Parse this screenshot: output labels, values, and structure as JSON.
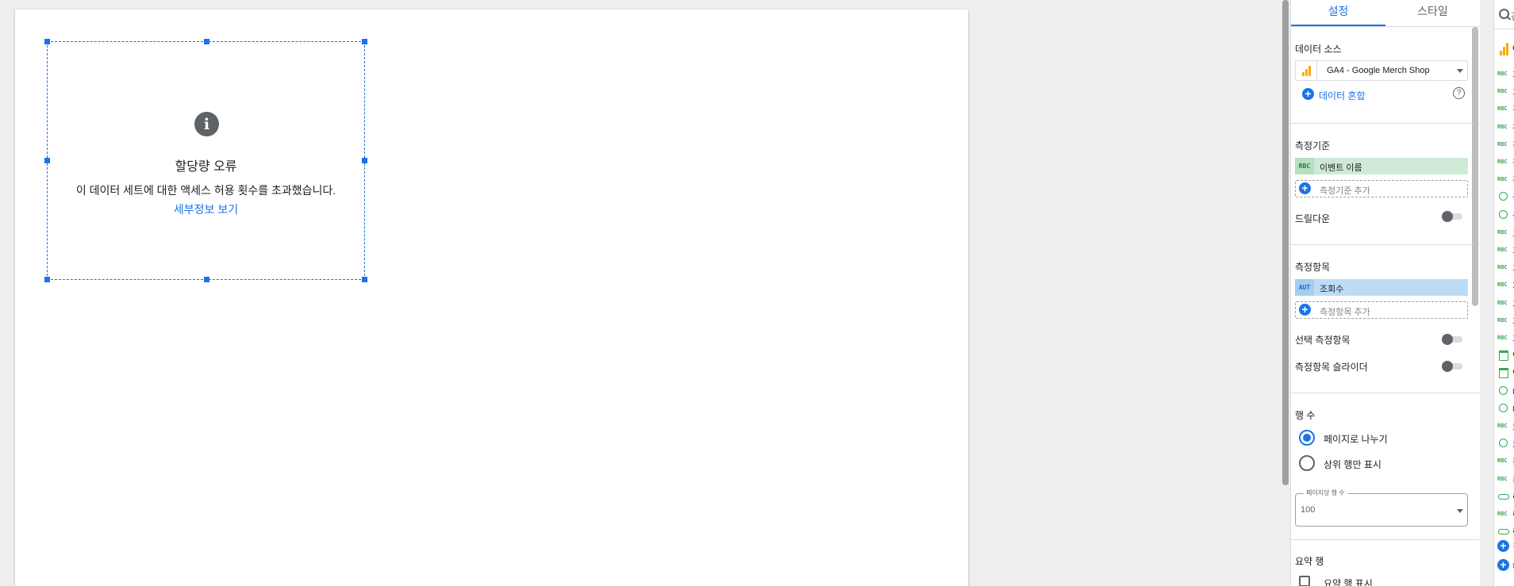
{
  "canvas": {
    "error": {
      "title": "할당량 오류",
      "message": "이 데이터 세트에 대한 액세스 허용 횟수를 초과했습니다.",
      "link": "세부정보 보기"
    }
  },
  "panel": {
    "tabs": [
      "설정",
      "스타일"
    ],
    "active_tab": "설정",
    "data_source": {
      "section_title": "데이터 소스",
      "name": "GA4 - Google Merch Shop",
      "blend_label": "데이터 혼합",
      "help": "?"
    },
    "dimension": {
      "section_title": "측정기준",
      "chip_tag": "RBC",
      "chip_label": "이벤트 이름",
      "add_label": "측정기준 추가",
      "drilldown_label": "드릴다운"
    },
    "metric": {
      "section_title": "측정항목",
      "chip_tag": "AUT",
      "chip_label": "조회수",
      "add_label": "측정항목 추가",
      "optional_label": "선택 측정항목",
      "slider_label": "측정항목 슬라이더"
    },
    "rows": {
      "section_title": "행 수",
      "option_paginate": "페이지로 나누기",
      "option_top": "상위 행만 표시",
      "selected": "페이지로 나누기",
      "per_page_legend": "페이지당 행 수",
      "per_page_value": "100"
    },
    "summary": {
      "section_title": "요약 행",
      "show_label": "요약 행 표시"
    }
  },
  "fields": {
    "search_text": "검",
    "source_initial": "G",
    "items": [
      {
        "type": "text",
        "icon": "RBC",
        "label": "가"
      },
      {
        "type": "text",
        "icon": "RBC",
        "label": "기"
      },
      {
        "type": "text",
        "icon": "RBC",
        "label": "검"
      },
      {
        "type": "text",
        "icon": "RBC",
        "label": "관"
      },
      {
        "type": "text",
        "icon": "RBC",
        "label": "광"
      },
      {
        "type": "text",
        "icon": "RBC",
        "label": "광"
      },
      {
        "type": "text",
        "icon": "RBC",
        "label": "광"
      },
      {
        "type": "geo",
        "icon": "globe-icon",
        "label": "국"
      },
      {
        "type": "geo",
        "icon": "globe-icon",
        "label": "국"
      },
      {
        "type": "text",
        "icon": "RBC",
        "label": "그"
      },
      {
        "type": "text",
        "icon": "RBC",
        "label": "기"
      },
      {
        "type": "text",
        "icon": "RBC",
        "label": "기"
      },
      {
        "type": "text",
        "icon": "RBC",
        "label": "기"
      },
      {
        "type": "text",
        "icon": "RBC",
        "label": "기"
      },
      {
        "type": "text",
        "icon": "RBC",
        "label": "기"
      },
      {
        "type": "text",
        "icon": "RBC",
        "label": "기"
      },
      {
        "type": "date",
        "icon": "calendar-icon",
        "label": "날"
      },
      {
        "type": "date",
        "icon": "calendar-icon",
        "label": "날"
      },
      {
        "type": "geo",
        "icon": "globe-icon",
        "label": "대"
      },
      {
        "type": "geo",
        "icon": "globe-icon",
        "label": "대"
      },
      {
        "type": "text",
        "icon": "RBC",
        "label": "도"
      },
      {
        "type": "geo",
        "icon": "globe-icon",
        "label": "도"
      },
      {
        "type": "text",
        "icon": "RBC",
        "label": "동"
      },
      {
        "type": "text",
        "icon": "RBC",
        "label": "동"
      },
      {
        "type": "link",
        "icon": "link-icon",
        "label": "랜"
      },
      {
        "type": "text",
        "icon": "RBC",
        "label": "랭"
      },
      {
        "type": "link",
        "icon": "link-icon",
        "label": "링"
      }
    ],
    "add_field": "필",
    "add_param": "매"
  }
}
